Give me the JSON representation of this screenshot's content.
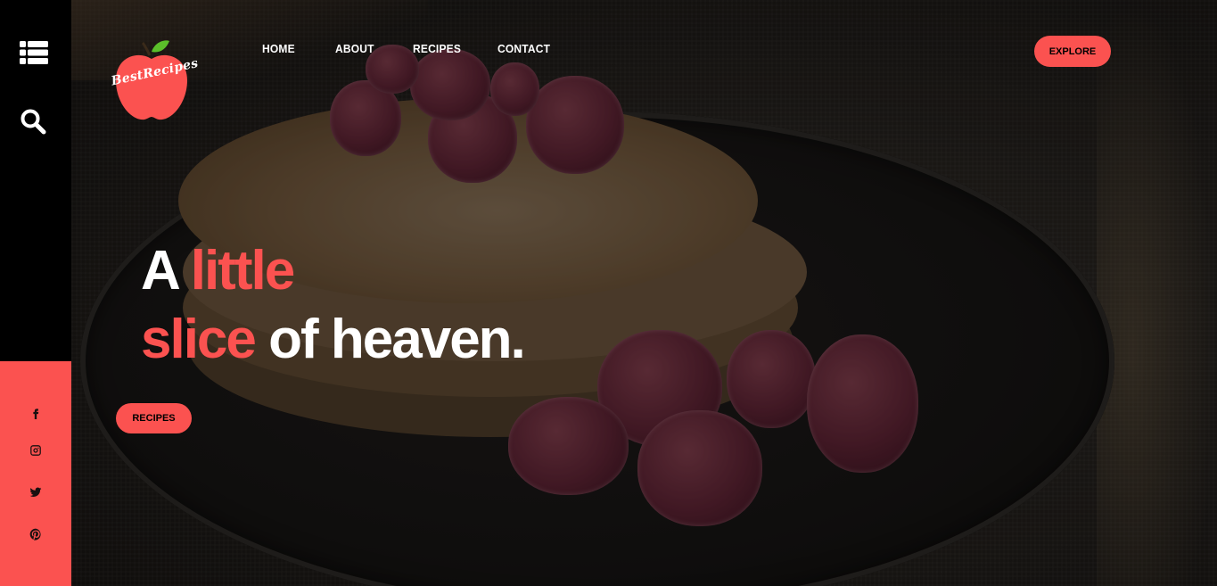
{
  "brand": {
    "logo_text": "BestRecipes"
  },
  "nav": {
    "items": [
      {
        "label": "HOME"
      },
      {
        "label": "ABOUT"
      },
      {
        "label": "RECIPES"
      },
      {
        "label": "CONTACT"
      }
    ],
    "cta_label": "EXPLORE"
  },
  "sidebar": {
    "icons": [
      "list-menu-icon",
      "search-icon"
    ],
    "social": [
      "facebook-icon",
      "instagram-icon",
      "twitter-icon",
      "pinterest-icon"
    ]
  },
  "hero": {
    "line1_white": "A",
    "line1_accent": "little",
    "line2_accent": "slice",
    "line2_white": "of heaven.",
    "button_label": "RECIPES"
  },
  "colors": {
    "accent": "#fb5250",
    "sidebar_bg": "#000000",
    "text_light": "#ffffff"
  }
}
